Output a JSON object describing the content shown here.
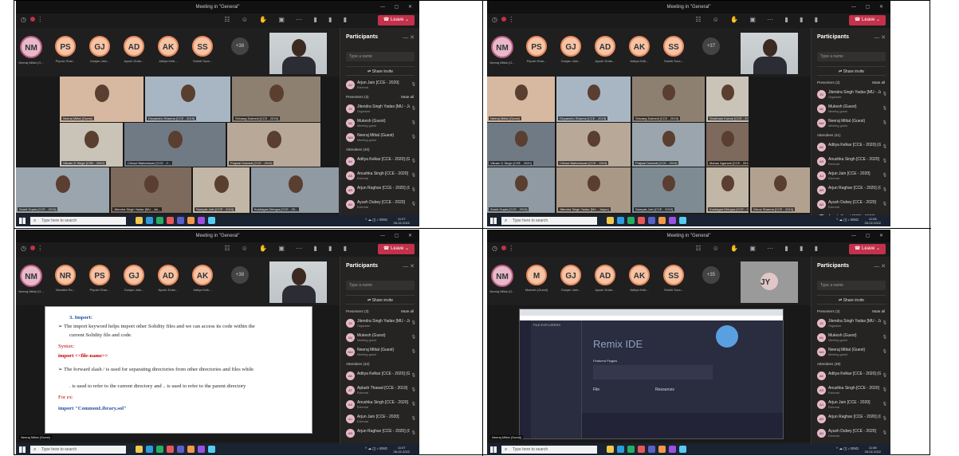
{
  "window_title": "Meeting in \"General\"",
  "leave_label": "Leave",
  "participants_title": "Participants",
  "search_placeholder": "Type a name",
  "share_invite": "Share invite",
  "mute_all": "Mute all",
  "taskbar_search": "Type here to search",
  "time_q1": "11:07",
  "date": "26-02-2022",
  "time_q2": "11:08",
  "shot1": {
    "avatars": [
      {
        "initials": "NM",
        "name": "Neeraj Mittal (G..."
      },
      {
        "initials": "PS",
        "name": "Piyush Shar..."
      },
      {
        "initials": "GJ",
        "name": "Gunjan Jain..."
      },
      {
        "initials": "AD",
        "name": "Ayush Dube..."
      },
      {
        "initials": "AK",
        "name": "Aditya Kelk..."
      },
      {
        "initials": "SS",
        "name": "Srishti Sura..."
      }
    ],
    "more": "+38",
    "tiles": [
      {
        "label": "Neeraj Mittal (Guest)"
      },
      {
        "label": "Divyanshu Sharma [CCE - 2019]"
      },
      {
        "label": "Shivang Dwivedi [CCE - 2019]"
      },
      {
        "label": "Vikram D Singh [CSE - 2020]"
      },
      {
        "label": "Chhavi Maheshwar [CCE - 2..."
      },
      {
        "label": "Prajwal Dwivedi [CCE - 2019]"
      },
      {
        "label": "Sumit Gupta [CCE - 2019]"
      },
      {
        "label": "Jitendra Singh Yadav [MU - Jai..."
      },
      {
        "label": "Samyak Jain [CCE - 2019]"
      },
      {
        "label": "Kushagra Dhingra [CCE - 20..."
      }
    ],
    "participants": [
      {
        "section": "",
        "name": "Arjun Jain [CCE - 2020]",
        "role": "External"
      },
      {
        "section": "Presenters (3)",
        "name": "Jitendra Singh Yadav [MU - Jaip...",
        "role": "Organizer"
      },
      {
        "section": "",
        "name": "Mukesh (Guest)",
        "role": "Meeting guest"
      },
      {
        "section": "",
        "name": "Neeraj Mittal (Guest)",
        "role": "Meeting guest"
      },
      {
        "section": "Attendees (40)",
        "name": "Aditya Kelkar [CCE - 2020] (Guest)",
        "role": ""
      },
      {
        "section": "",
        "name": "Anushka Singh [CCE - 2020]",
        "role": "External"
      },
      {
        "section": "",
        "name": "Arjun Raghav [CCE - 2020] (Guest)",
        "role": ""
      },
      {
        "section": "",
        "name": "Ayush Dubey [CCE - 2020]",
        "role": "External"
      }
    ]
  },
  "shot2": {
    "avatars": [
      {
        "initials": "NM",
        "name": "Neeraj Mittal (G..."
      },
      {
        "initials": "PS",
        "name": "Piyush Shar..."
      },
      {
        "initials": "GJ",
        "name": "Gunjan Jain..."
      },
      {
        "initials": "AD",
        "name": "Ayush Dube..."
      },
      {
        "initials": "AK",
        "name": "Aditya Kelk..."
      },
      {
        "initials": "SS",
        "name": "Srishti Sura..."
      }
    ],
    "more": "+37",
    "tiles": [
      {
        "label": "Neeraj Mittal (Guest)"
      },
      {
        "label": "Divyanshu Sharma [CCE - 2019]"
      },
      {
        "label": "Shivang Dwivedi [CCE - 2019]"
      },
      {
        "label": "Shubham Kumar [CCE - 2019]"
      },
      {
        "label": "Vikram D Singh [CSE - 2020]"
      },
      {
        "label": "Chhavi Maheshwari [CCE - 2019]"
      },
      {
        "label": "Prajwal Dwivedi [CCE - 2019]"
      },
      {
        "label": "Manan Agarwal [CCE - 2019]"
      },
      {
        "label": "Kushagra Dhingra [CCE - 2019]"
      },
      {
        "label": "Sumit Gupta [CCE - 2019]"
      },
      {
        "label": "Jitendra Singh Yadav [MU - Jaipur]"
      },
      {
        "label": "Samyak Jain [CCE - 2019]"
      },
      {
        "label": "Dhruv Sharma [CCE - 2019]"
      }
    ],
    "participants": [
      {
        "section": "Presenters (3)",
        "name": "Jitendra Singh Yadav [MU - Jaip...",
        "role": "Organizer"
      },
      {
        "section": "",
        "name": "Mukesh (Guest)",
        "role": "Meeting guest"
      },
      {
        "section": "",
        "name": "Neeraj Mittal (Guest)",
        "role": "Meeting guest"
      },
      {
        "section": "Attendees (41)",
        "name": "Aditya Kelkar [CCE - 2020] (Guest)",
        "role": ""
      },
      {
        "section": "",
        "name": "Anushka Singh [CCE - 2020]",
        "role": "External"
      },
      {
        "section": "",
        "name": "Arjun Jain [CCE - 2020]",
        "role": "External"
      },
      {
        "section": "",
        "name": "Arjun Raghav [CCE - 2020] (Guest)",
        "role": ""
      },
      {
        "section": "",
        "name": "Ayush Dubey [CCE - 2020]",
        "role": "External"
      },
      {
        "section": "",
        "name": "Ayush Goyal [CCE - 2020]",
        "role": "External"
      }
    ]
  },
  "shot3": {
    "avatars": [
      {
        "initials": "NM",
        "name": "Neeraj Mittal (G..."
      },
      {
        "initials": "NR",
        "name": "Nivedita Ra..."
      },
      {
        "initials": "PS",
        "name": "Piyush Shar..."
      },
      {
        "initials": "GJ",
        "name": "Gunjan Jain..."
      },
      {
        "initials": "AD",
        "name": "Ayush Dube..."
      },
      {
        "initials": "AK",
        "name": "Aditya Kelk..."
      }
    ],
    "more": "+38",
    "doc": {
      "heading": "3. Import:",
      "b1a": "➢  The import keyword helps import other Solidity files and we can access its code within the",
      "b1b": "current Solidity file and code.",
      "syntax": "Syntax:",
      "syntax_line": "import <<file-name>>",
      "b2a": "➢  The forward slash / is used for separating directories from other directories and files while",
      "b2b": ". is used to refer to the current directory and .. is used to refer to the parent directory",
      "forex": "For ex:",
      "ex_line": "import \"CommonLibrary.sol\""
    },
    "bottom_label": "Neeraj Mittal (Guest)",
    "participants": [
      {
        "section": "Presenters (3)",
        "name": "Jitendra Singh Yadav [MU - Jaip...",
        "role": "Organizer"
      },
      {
        "section": "",
        "name": "Mukesh (Guest)",
        "role": "Meeting guest"
      },
      {
        "section": "",
        "name": "Neeraj Mittal (Guest)",
        "role": "Meeting guest"
      },
      {
        "section": "Attendees (42)",
        "name": "Aditya Kelkar [CCE - 2020] (Guest)",
        "role": ""
      },
      {
        "section": "",
        "name": "Aplash Thawal [CCE - 2019]",
        "role": "External"
      },
      {
        "section": "",
        "name": "Anushka Singh [CCE - 2020]",
        "role": "External"
      },
      {
        "section": "",
        "name": "Arjun Jain [CCE - 2020]",
        "role": "External"
      },
      {
        "section": "",
        "name": "Arjun Raghav [CCE - 2020] (Guest)",
        "role": ""
      }
    ]
  },
  "shot4": {
    "avatars": [
      {
        "initials": "NM",
        "name": "Neeraj Mittal (G..."
      },
      {
        "initials": "M",
        "name": "Mukesh (Guest)"
      },
      {
        "initials": "GJ",
        "name": "Gunjan Jain..."
      },
      {
        "initials": "AD",
        "name": "Ayush Dube..."
      },
      {
        "initials": "AK",
        "name": "Aditya Kelk..."
      },
      {
        "initials": "SS",
        "name": "Srishti Sura..."
      }
    ],
    "more": "+35",
    "self_initials": "JY",
    "remix_title": "Remix IDE",
    "file_explorers": "FILE EXPLORERS",
    "featured": "Featured Plugins",
    "file": "File",
    "resources": "Resources",
    "bottom_label": "Neeraj Mittal (Guest)",
    "participants": [
      {
        "section": "Presenters (3)",
        "name": "Jitendra Singh Yadav [MU - Jaip...",
        "role": "Organizer"
      },
      {
        "section": "",
        "name": "Mukesh (Guest)",
        "role": "Meeting guest"
      },
      {
        "section": "",
        "name": "Neeraj Mittal (Guest)",
        "role": "Meeting guest"
      },
      {
        "section": "Attendees (39)",
        "name": "Aditya Kelkar [CCE - 2020] (Guest)",
        "role": ""
      },
      {
        "section": "",
        "name": "Anushka Singh [CCE - 2020]",
        "role": "External"
      },
      {
        "section": "",
        "name": "Arjun Jain [CCE - 2020]",
        "role": "External"
      },
      {
        "section": "",
        "name": "Arjun Raghav [CCE - 2020] (Guest)",
        "role": ""
      },
      {
        "section": "",
        "name": "Ayush Dubey [CCE - 2020]",
        "role": "External"
      }
    ]
  }
}
